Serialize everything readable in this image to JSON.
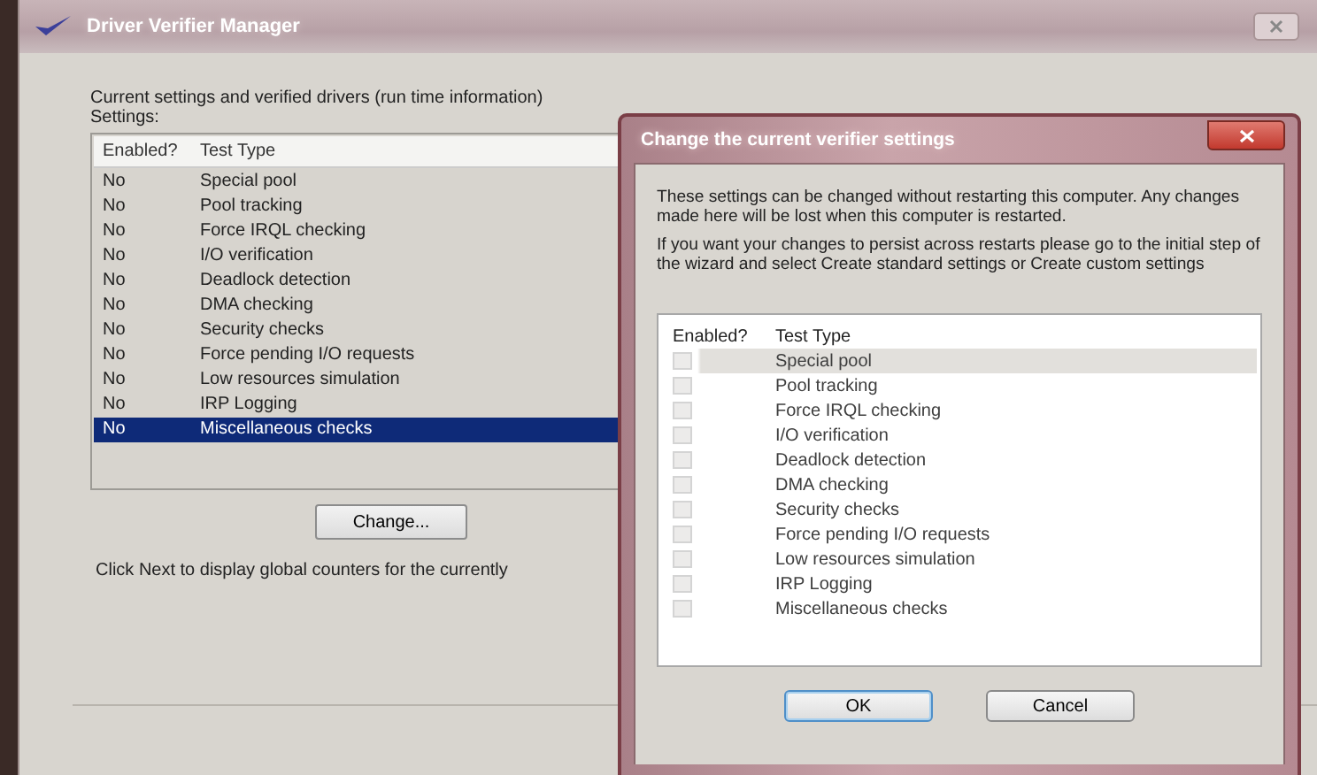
{
  "window": {
    "title": "Driver Verifier Manager"
  },
  "intro": "Current settings and verified drivers (run time information)",
  "settings_label": "Settings:",
  "settings_list": {
    "columns": [
      "Enabled?",
      "Test Type"
    ],
    "rows": [
      {
        "enabled": "No",
        "test_type": "Special pool",
        "selected": false
      },
      {
        "enabled": "No",
        "test_type": "Pool tracking",
        "selected": false
      },
      {
        "enabled": "No",
        "test_type": "Force IRQL checking",
        "selected": false
      },
      {
        "enabled": "No",
        "test_type": "I/O verification",
        "selected": false
      },
      {
        "enabled": "No",
        "test_type": "Deadlock detection",
        "selected": false
      },
      {
        "enabled": "No",
        "test_type": "DMA checking",
        "selected": false
      },
      {
        "enabled": "No",
        "test_type": "Security checks",
        "selected": false
      },
      {
        "enabled": "No",
        "test_type": "Force pending I/O requests",
        "selected": false
      },
      {
        "enabled": "No",
        "test_type": "Low resources simulation",
        "selected": false
      },
      {
        "enabled": "No",
        "test_type": "IRP Logging",
        "selected": false
      },
      {
        "enabled": "No",
        "test_type": "Miscellaneous checks",
        "selected": true
      }
    ]
  },
  "change_button": "Change...",
  "hint": "Click Next to display global counters for the currently",
  "dialog": {
    "title": "Change the current verifier settings",
    "paragraphs": [
      "These settings can be changed without restarting this computer. Any changes made here will be lost when this computer is restarted.",
      "If you want your changes to persist across restarts please go to the initial step of the wizard and select Create standard settings or Create custom settings"
    ],
    "columns": [
      "Enabled?",
      "Test Type"
    ],
    "rows": [
      {
        "test_type": "Special pool",
        "checked": false,
        "disabled": true,
        "selected": true
      },
      {
        "test_type": "Pool tracking",
        "checked": false,
        "disabled": true,
        "selected": false
      },
      {
        "test_type": "Force IRQL checking",
        "checked": false,
        "disabled": true,
        "selected": false
      },
      {
        "test_type": "I/O verification",
        "checked": false,
        "disabled": true,
        "selected": false
      },
      {
        "test_type": "Deadlock detection",
        "checked": false,
        "disabled": true,
        "selected": false
      },
      {
        "test_type": "DMA checking",
        "checked": false,
        "disabled": true,
        "selected": false
      },
      {
        "test_type": "Security checks",
        "checked": false,
        "disabled": true,
        "selected": false
      },
      {
        "test_type": "Force pending I/O requests",
        "checked": false,
        "disabled": true,
        "selected": false
      },
      {
        "test_type": "Low resources simulation",
        "checked": false,
        "disabled": true,
        "selected": false
      },
      {
        "test_type": "IRP Logging",
        "checked": false,
        "disabled": true,
        "selected": false
      },
      {
        "test_type": "Miscellaneous checks",
        "checked": false,
        "disabled": true,
        "selected": false
      }
    ],
    "buttons": [
      {
        "label": "OK",
        "kind": "default"
      },
      {
        "label": "Cancel",
        "kind": "normal"
      }
    ]
  }
}
